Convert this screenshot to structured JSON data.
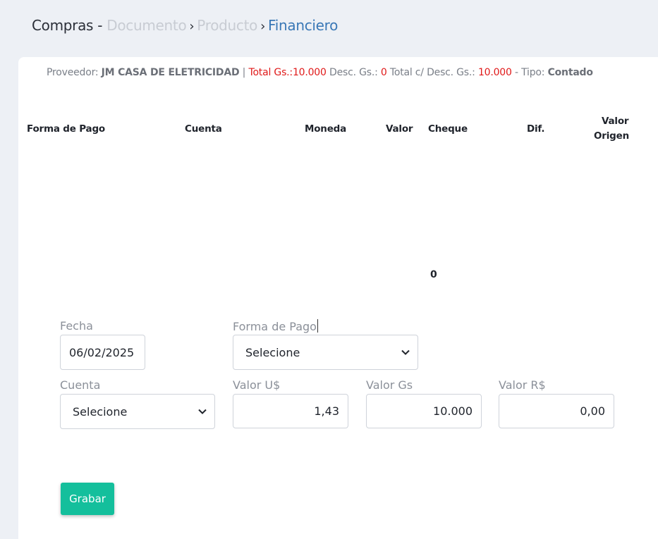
{
  "breadcrumb": {
    "root": "Compras",
    "separator": "-",
    "items": [
      "Documento",
      "Producto",
      "Financiero"
    ],
    "arrow": "›"
  },
  "summary": {
    "proveedor_label": "Proveedor:",
    "proveedor_value": "JM CASA DE ELETRICIDAD",
    "pipe": "|",
    "total_label": "Total Gs.:",
    "total_value": "10.000",
    "desc_label": "Desc. Gs.:",
    "desc_value": "0",
    "total_desc_label": "Total c/ Desc. Gs.:",
    "total_desc_value": "10.000",
    "tipo_label": "- Tipo:",
    "tipo_value": "Contado"
  },
  "table": {
    "headers": [
      "Forma de Pago",
      "Cuenta",
      "Moneda",
      "Valor",
      "Cheque",
      "Dif.",
      "Valor",
      "Origen"
    ],
    "total_value": "0"
  },
  "form": {
    "fecha_label": "Fecha",
    "fecha_value": "06/02/2025",
    "forma_pago_label": "Forma de Pago",
    "forma_pago_value": "Selecione",
    "cuenta_label": "Cuenta",
    "cuenta_value": "Selecione",
    "valor_usd_label": "Valor U$",
    "valor_usd_value": "1,43",
    "valor_gs_label": "Valor Gs",
    "valor_gs_value": "10.000",
    "valor_brl_label": "Valor R$",
    "valor_brl_value": "0,00"
  },
  "actions": {
    "grabar_label": "Grabar"
  },
  "colors": {
    "accent": "#14bf9c",
    "link": "#3a78b6",
    "alert": "#e01a1a"
  }
}
